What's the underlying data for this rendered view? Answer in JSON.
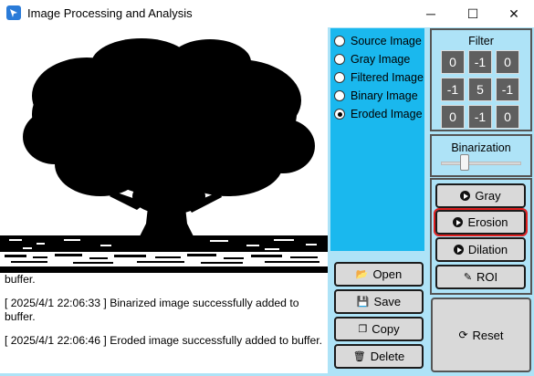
{
  "window": {
    "title": "Image Processing and Analysis",
    "minimize_glyph": "─",
    "maximize_glyph": "☐",
    "close_glyph": "✕"
  },
  "image_view": {
    "mode": "Eroded Image",
    "description_icon": "tree-silhouette"
  },
  "log": {
    "lines": [
      "buffer.",
      "[ 2025/4/1 22:06:33 ] Binarized image successfully added to buffer.",
      "[ 2025/4/1 22:06:46 ] Eroded image successfully added to buffer."
    ]
  },
  "image_options": [
    {
      "label": "Source Image",
      "checked": false
    },
    {
      "label": "Gray Image",
      "checked": false
    },
    {
      "label": "Filtered Image",
      "checked": false
    },
    {
      "label": "Binary Image",
      "checked": false
    },
    {
      "label": "Eroded Image",
      "checked": true
    }
  ],
  "file_buttons": {
    "open": {
      "label": "Open",
      "icon": "folder-open-icon"
    },
    "save": {
      "label": "Save",
      "icon": "floppy-disk-icon"
    },
    "copy": {
      "label": "Copy",
      "icon": "copy-icon"
    },
    "delete": {
      "label": "Delete",
      "icon": "trash-icon"
    }
  },
  "filter": {
    "title": "Filter",
    "kernel": [
      "0",
      "-1",
      "0",
      "-1",
      "5",
      "-1",
      "0",
      "-1",
      "0"
    ]
  },
  "binarization": {
    "title": "Binarization",
    "slider_fraction": 0.3
  },
  "operations": {
    "gray": {
      "label": "Gray",
      "icon": "play-circle-icon"
    },
    "erosion": {
      "label": "Erosion",
      "icon": "play-circle-icon",
      "active": true
    },
    "dilation": {
      "label": "Dilation",
      "icon": "play-circle-icon"
    },
    "roi": {
      "label": "ROI",
      "icon": "edit-icon"
    }
  },
  "reset": {
    "label": "Reset",
    "icon": "refresh-icon"
  },
  "colors": {
    "panel_blue": "#aee3f7",
    "radio_blue": "#1ab8ee",
    "button_gray": "#d9d9d9",
    "kernel_cell": "#5f5f5f",
    "active_outline": "#e02020"
  }
}
